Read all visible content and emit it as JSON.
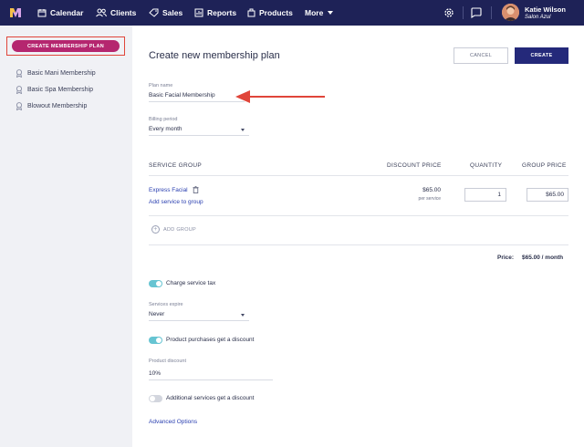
{
  "nav": {
    "items": [
      {
        "label": "Calendar",
        "icon": "calendar-icon"
      },
      {
        "label": "Clients",
        "icon": "clients-icon"
      },
      {
        "label": "Sales",
        "icon": "tag-icon"
      },
      {
        "label": "Reports",
        "icon": "reports-icon"
      },
      {
        "label": "Products",
        "icon": "products-icon"
      },
      {
        "label": "More",
        "icon": "chevron-down-icon"
      }
    ],
    "user": {
      "name": "Katie Wilson",
      "salon": "Salon Azul"
    },
    "colors": {
      "bar": "#1e2257",
      "accent": "#b5266f"
    }
  },
  "sidebar": {
    "create_button": "CREATE MEMBERSHIP PLAN",
    "plans": [
      "Basic Mani Membership",
      "Basic Spa Membership",
      "Blowout Membership"
    ]
  },
  "main": {
    "title": "Create new membership plan",
    "cancel_label": "CANCEL",
    "create_label": "CREATE",
    "plan_name": {
      "label": "Plan name",
      "value": "Basic Facial Membership"
    },
    "billing_period": {
      "label": "Billing period",
      "value": "Every month"
    },
    "table": {
      "headers": [
        "SERVICE GROUP",
        "DISCOUNT PRICE",
        "QUANTITY",
        "GROUP PRICE"
      ],
      "row": {
        "service": "Express Facial",
        "add_service": "Add service to group",
        "discount_price": "$65.00",
        "per_service": "per service",
        "quantity": "1",
        "group_price": "$65.00"
      },
      "add_group": "ADD GROUP"
    },
    "price_label": "Price:",
    "price_total": "$65.00 / month",
    "charge_tax": {
      "label": "Charge service tax",
      "on": true
    },
    "services_expire": {
      "label": "Services expire",
      "value": "Never"
    },
    "product_discount_toggle": {
      "label": "Product purchases get a discount",
      "on": true
    },
    "product_discount": {
      "label": "Product discount",
      "value": "10%"
    },
    "additional_services": {
      "label": "Additional services get a discount",
      "on": false
    },
    "advanced_options": "Advanced Options"
  }
}
